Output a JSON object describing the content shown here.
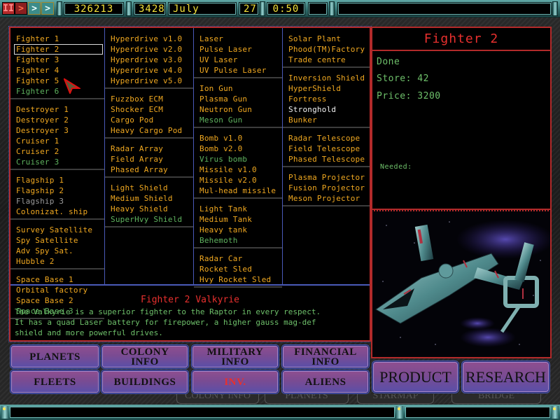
{
  "topbar": {
    "controls": [
      {
        "name": "pause",
        "glyph": "II"
      },
      {
        "name": "play",
        "glyph": ">"
      },
      {
        "name": "fast-forward",
        "glyph": ">"
      },
      {
        "name": "fastest-forward",
        "glyph": ">"
      }
    ],
    "money": "326213",
    "population": "3428",
    "month": "July",
    "day": "27",
    "time": "0:50",
    "status_message": ""
  },
  "lists": {
    "col1": [
      [
        {
          "label": "Fighter 1",
          "state": "available"
        },
        {
          "label": "Fighter 2",
          "state": "selected"
        },
        {
          "label": "Fighter 3",
          "state": "available"
        },
        {
          "label": "Fighter 4",
          "state": "available"
        },
        {
          "label": "Fighter 5",
          "state": "available"
        },
        {
          "label": "Fighter 6",
          "state": "researching"
        }
      ],
      [
        {
          "label": "Destroyer 1",
          "state": "available"
        },
        {
          "label": "Destroyer 2",
          "state": "available"
        },
        {
          "label": "Destroyer 3",
          "state": "available"
        },
        {
          "label": "Cruiser 1",
          "state": "available"
        },
        {
          "label": "Cruiser 2",
          "state": "available"
        },
        {
          "label": "Cruiser 3",
          "state": "researching"
        }
      ],
      [
        {
          "label": "Flagship 1",
          "state": "available"
        },
        {
          "label": "Flagship 2",
          "state": "available"
        },
        {
          "label": "Flagship 3",
          "state": "unavailable"
        },
        {
          "label": "Colonizat. ship",
          "state": "available"
        }
      ],
      [
        {
          "label": "Survey Satellite",
          "state": "available"
        },
        {
          "label": "Spy Satellite",
          "state": "available"
        },
        {
          "label": "Adv Spy Sat.",
          "state": "available"
        },
        {
          "label": "Hubble 2",
          "state": "available"
        }
      ],
      [
        {
          "label": "Space Base 1",
          "state": "available"
        },
        {
          "label": "Orbital factory",
          "state": "available"
        },
        {
          "label": "Space Base 2",
          "state": "available"
        },
        {
          "label": "Space Base 3",
          "state": "researching"
        }
      ]
    ],
    "col2": [
      [
        {
          "label": "Hyperdrive v1.0",
          "state": "available"
        },
        {
          "label": "Hyperdrive v2.0",
          "state": "available"
        },
        {
          "label": "Hyperdrive v3.0",
          "state": "available"
        },
        {
          "label": "Hyperdrive v4.0",
          "state": "available"
        },
        {
          "label": "Hyperdrive v5.0",
          "state": "available"
        }
      ],
      [
        {
          "label": "Fuzzbox ECM",
          "state": "available"
        },
        {
          "label": "Shocker ECM",
          "state": "available"
        },
        {
          "label": "Cargo Pod",
          "state": "available"
        },
        {
          "label": "Heavy Cargo Pod",
          "state": "available"
        }
      ],
      [
        {
          "label": "Radar Array",
          "state": "available"
        },
        {
          "label": "Field Array",
          "state": "available"
        },
        {
          "label": "Phased Array",
          "state": "available"
        }
      ],
      [
        {
          "label": "Light Shield",
          "state": "available"
        },
        {
          "label": "Medium Shield",
          "state": "available"
        },
        {
          "label": "Heavy Shield",
          "state": "available"
        },
        {
          "label": "SuperHvy Shield",
          "state": "researching"
        }
      ]
    ],
    "col3": [
      [
        {
          "label": "Laser",
          "state": "available"
        },
        {
          "label": "Pulse Laser",
          "state": "available"
        },
        {
          "label": "UV Laser",
          "state": "available"
        },
        {
          "label": "UV Pulse Laser",
          "state": "available"
        }
      ],
      [
        {
          "label": "Ion Gun",
          "state": "available"
        },
        {
          "label": "Plasma Gun",
          "state": "available"
        },
        {
          "label": "Neutron Gun",
          "state": "available"
        },
        {
          "label": "Meson Gun",
          "state": "researching"
        }
      ],
      [
        {
          "label": "Bomb v1.0",
          "state": "available"
        },
        {
          "label": "Bomb v2.0",
          "state": "available"
        },
        {
          "label": "Virus bomb",
          "state": "researching"
        },
        {
          "label": "Missile v1.0",
          "state": "available"
        },
        {
          "label": "Missile v2.0",
          "state": "available"
        },
        {
          "label": "Mul-head missile",
          "state": "available"
        }
      ],
      [
        {
          "label": "Light Tank",
          "state": "available"
        },
        {
          "label": "Medium Tank",
          "state": "available"
        },
        {
          "label": "Heavy tank",
          "state": "available"
        },
        {
          "label": "Behemoth",
          "state": "researching"
        }
      ],
      [
        {
          "label": "Radar Car",
          "state": "available"
        },
        {
          "label": "Rocket Sled",
          "state": "available"
        },
        {
          "label": "Hvy Rocket Sled",
          "state": "available"
        }
      ]
    ],
    "col4": [
      [
        {
          "label": "Solar Plant",
          "state": "available"
        },
        {
          "label": "Phood(TM)Factory",
          "state": "available"
        },
        {
          "label": "Trade centre",
          "state": "available"
        }
      ],
      [
        {
          "label": "Inversion Shield",
          "state": "available"
        },
        {
          "label": "HyperShield",
          "state": "available"
        },
        {
          "label": "Fortress",
          "state": "available"
        },
        {
          "label": "Stronghold",
          "state": "built"
        },
        {
          "label": "Bunker",
          "state": "available"
        }
      ],
      [
        {
          "label": "Radar Telescope",
          "state": "available"
        },
        {
          "label": "Field Telescope",
          "state": "available"
        },
        {
          "label": "Phased Telescope",
          "state": "available"
        }
      ],
      [
        {
          "label": "Plasma Projector",
          "state": "available"
        },
        {
          "label": "Fusion Projector",
          "state": "available"
        },
        {
          "label": "Meson Projector",
          "state": "available"
        }
      ]
    ]
  },
  "description": {
    "title": "Fighter 2 Valkyrie",
    "body": "The Valkyrie is a superior fighter to the Raptor in every respect.\nIt has a quad Laser battery for firepower, a higher gauss mag-def\nshield and more powerful drives."
  },
  "detail": {
    "title": "Fighter 2",
    "status": "Done",
    "store": "Store: 42",
    "price": "Price: 3200",
    "needed": "Needed:"
  },
  "nav": {
    "row1": [
      "PLANETS",
      "COLONY\nINFO",
      "MILITARY\nINFO",
      "FINANCIAL\nINFO"
    ],
    "row2": [
      "FLEETS",
      "BUILDINGS",
      "INV.",
      "ALIENS"
    ],
    "active": "INV.",
    "product": "PRODUCT",
    "research": "RESEARCH"
  },
  "background_tabs": [
    "COLONY INFO",
    "PLANETS",
    "STARMAP",
    "BRIDGE"
  ],
  "colors": {
    "available": "#f0a820",
    "researching": "#5fb35f",
    "built": "#f2f2f2",
    "unavailable": "#9a9a9a",
    "title_red": "#e8302e",
    "readout_yellow": "#f4e23a"
  }
}
